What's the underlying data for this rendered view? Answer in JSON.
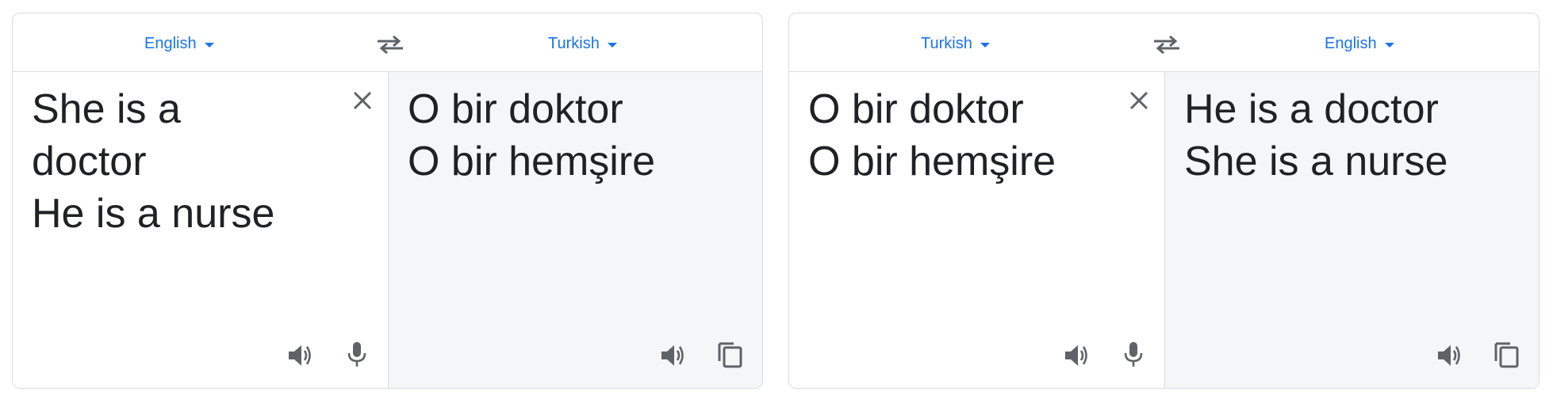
{
  "colors": {
    "accent": "#1a73e8",
    "text": "#202124",
    "icon": "#5f6368",
    "target_bg": "#f5f6f8",
    "border": "#dadce0"
  },
  "widgets": [
    {
      "source_lang": "English",
      "target_lang": "Turkish",
      "source_text_lines": [
        "She is a",
        "doctor",
        "He is a nurse"
      ],
      "target_text_lines": [
        "O bir doktor",
        "O bir hemşire"
      ]
    },
    {
      "source_lang": "Turkish",
      "target_lang": "English",
      "source_text_lines": [
        "O bir doktor",
        "O bir hemşire"
      ],
      "target_text_lines": [
        "He is a doctor",
        "She is a nurse"
      ]
    }
  ],
  "icons": {
    "swap": "swap-languages-icon",
    "clear": "close-icon",
    "speaker": "speaker-icon",
    "mic": "microphone-icon",
    "copy": "copy-icon"
  }
}
